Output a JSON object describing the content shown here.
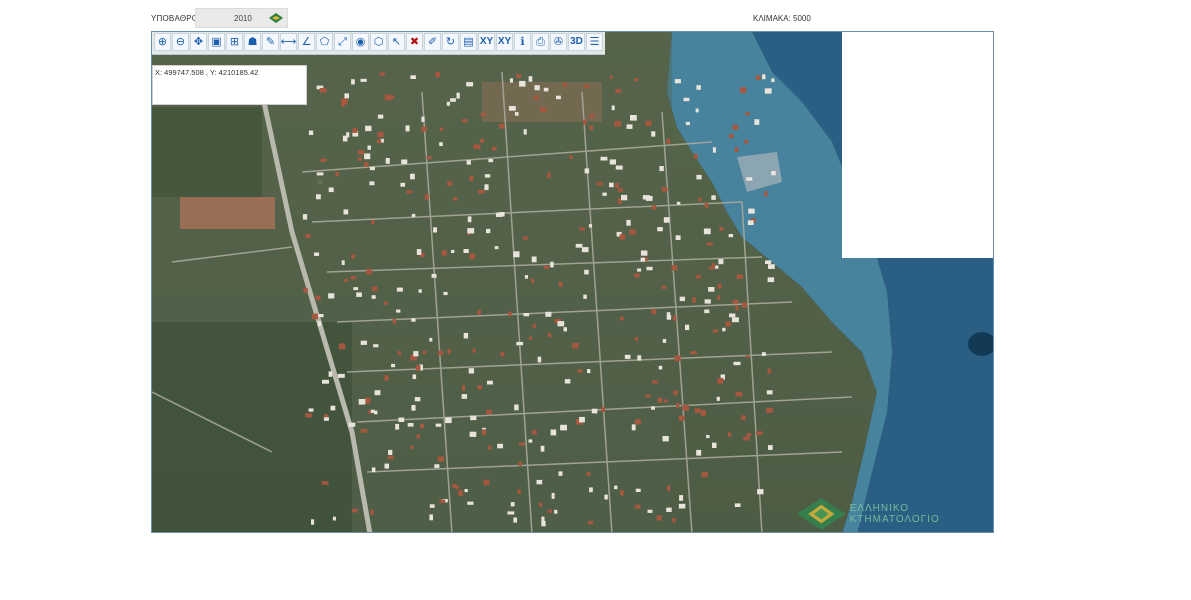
{
  "header": {
    "base_label": "ΥΠΟΒΑΘΡΟ:",
    "base_value": "2010",
    "scale_label": "ΚΛΙΜΑΚΑ: 5000"
  },
  "map": {
    "coordinates": "X: 499747.508 , Y: 4210185.42",
    "watermark": "ΕΛΛΗΝΙΚΟ ΚΤΗΜΑΤΟΛΟΓΙΟ"
  },
  "toolbar": {
    "tools": [
      {
        "name": "zoom-in-icon",
        "glyph": "⊕"
      },
      {
        "name": "zoom-out-icon",
        "glyph": "⊖"
      },
      {
        "name": "pan-icon",
        "glyph": "✥"
      },
      {
        "name": "zoom-box-icon",
        "glyph": "▣"
      },
      {
        "name": "zoom-extent-icon",
        "glyph": "⊞"
      },
      {
        "name": "identify-person-icon",
        "glyph": "☗"
      },
      {
        "name": "search-area-icon",
        "glyph": "✎"
      },
      {
        "name": "measure-distance-icon",
        "glyph": "⟷"
      },
      {
        "name": "measure-angle-icon",
        "glyph": "∠"
      },
      {
        "name": "measure-polygon-icon",
        "glyph": "⬠"
      },
      {
        "name": "draw-line-icon",
        "glyph": "⤢"
      },
      {
        "name": "circle-point-icon",
        "glyph": "◉"
      },
      {
        "name": "polygon-select-icon",
        "glyph": "⬡"
      },
      {
        "name": "select-arrow-icon",
        "glyph": "↖"
      },
      {
        "name": "clear-icon",
        "glyph": "✖"
      },
      {
        "name": "edit-pen-icon",
        "glyph": "✐"
      },
      {
        "name": "refresh-icon",
        "glyph": "↻"
      },
      {
        "name": "document-icon",
        "glyph": "▤"
      },
      {
        "name": "coordinates-xy-icon",
        "glyph": "XY"
      },
      {
        "name": "coordinates-transform-icon",
        "glyph": "XY"
      },
      {
        "name": "info-icon",
        "glyph": "ℹ"
      },
      {
        "name": "print-icon",
        "glyph": "⎙"
      },
      {
        "name": "satellite-icon",
        "glyph": "✇"
      },
      {
        "name": "view-3d-icon",
        "glyph": "3D"
      },
      {
        "name": "legend-icon",
        "glyph": "☰"
      }
    ]
  },
  "colors": {
    "frame_border": "#6a8fb0",
    "sea_deep": "#1f4f73",
    "sea_shallow": "#4d8aa3",
    "vegetation": "#4d5c44",
    "watermark": "#7ec4a0"
  }
}
